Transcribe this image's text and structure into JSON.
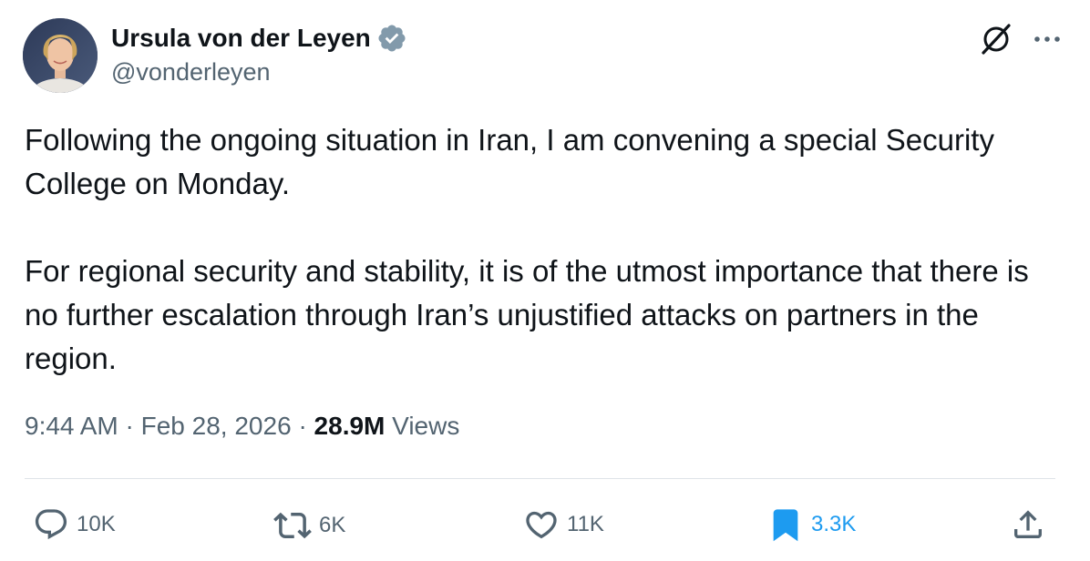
{
  "author": {
    "display_name": "Ursula von der Leyen",
    "handle": "@vonderleyen",
    "verified_badge": "verified-badge-icon",
    "verified_color": "#829aab"
  },
  "header_icons": {
    "grok": "grok-icon",
    "more": "more-icon"
  },
  "tweet": {
    "paragraph_1": "Following the ongoing situation in Iran, I am convening a special Security College on Monday.",
    "paragraph_2": "For regional security and stability, it is of the utmost importance that there is no further escalation through Iran’s unjustified attacks on partners in the region."
  },
  "meta": {
    "time": "9:44 AM",
    "separator_1": "·",
    "date": "Feb 28, 2026",
    "separator_2": "·",
    "views_count": "28.9M",
    "views_label": "Views"
  },
  "actions": {
    "reply": {
      "icon": "reply-icon",
      "count": "10K"
    },
    "repost": {
      "icon": "repost-icon",
      "count": "6K"
    },
    "like": {
      "icon": "heart-icon",
      "count": "11K"
    },
    "bookmark": {
      "icon": "bookmark-icon",
      "count": "3.3K",
      "active_color": "#1d9bf0"
    },
    "share": {
      "icon": "share-icon"
    }
  },
  "colors": {
    "primary_text": "#0f1419",
    "secondary_text": "#536471",
    "accent": "#1d9bf0",
    "divider": "#dfe4e8"
  }
}
